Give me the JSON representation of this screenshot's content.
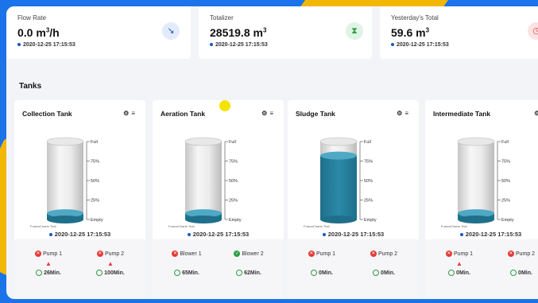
{
  "stats": [
    {
      "label": "Flow Rate",
      "value": "0.0 m",
      "sup": "3",
      "unit": "/h",
      "timestamp": "2020-12-25 17:15:53",
      "icon": "trend-down-icon"
    },
    {
      "label": "Totalizer",
      "value": "28519.8 m",
      "sup": "3",
      "unit": "",
      "timestamp": "2020-12-25 17:15:53",
      "icon": "hourglass-icon"
    },
    {
      "label": "Yesterday's Total",
      "value": "59.6 m",
      "sup": "3",
      "unit": "",
      "timestamp": "2020-12-25 17:15:53",
      "icon": "clock-icon"
    }
  ],
  "section_title": "Tanks",
  "tank_scale": {
    "full": "Full",
    "p75": "75%",
    "p50": "50%",
    "p25": "25%",
    "empty": "Empty",
    "credit": "FusionCharts Trial"
  },
  "tanks": [
    {
      "name": "Collection Tank",
      "level": 0.08,
      "timestamp": "2020-12-25 17:15:53",
      "equipment": [
        {
          "name": "Pump 1",
          "status": "off",
          "warning": true,
          "time": "26Min."
        },
        {
          "name": "Pump 2",
          "status": "off",
          "warning": true,
          "time": "100Min."
        }
      ]
    },
    {
      "name": "Aeration Tank",
      "level": 0.08,
      "timestamp": "2020-12-25 17:15:53",
      "equipment": [
        {
          "name": "Blower 1",
          "status": "off",
          "warning": false,
          "time": "65Min."
        },
        {
          "name": "Blower 2",
          "status": "on",
          "warning": false,
          "time": "62Min."
        }
      ]
    },
    {
      "name": "Sludge Tank",
      "level": 0.82,
      "timestamp": "2020-12-25 17:15:53",
      "equipment": [
        {
          "name": "Pump 1",
          "status": "off",
          "warning": false,
          "time": "0Min."
        },
        {
          "name": "Pump 2",
          "status": "off",
          "warning": false,
          "time": "0Min."
        }
      ]
    },
    {
      "name": "Intermediate Tank",
      "level": 0.08,
      "timestamp": "2020-12-25 17:15:53",
      "equipment": [
        {
          "name": "Pump 1",
          "status": "off",
          "warning": true,
          "time": "0Min."
        },
        {
          "name": "Pump 2",
          "status": "off",
          "warning": false,
          "time": "0Min."
        }
      ]
    }
  ],
  "colors": {
    "liquid": "#2a8aa8",
    "liquid_dark": "#1f6f8a",
    "off": "#e53935",
    "on": "#2e9e44",
    "accent": "#1a56c4"
  }
}
